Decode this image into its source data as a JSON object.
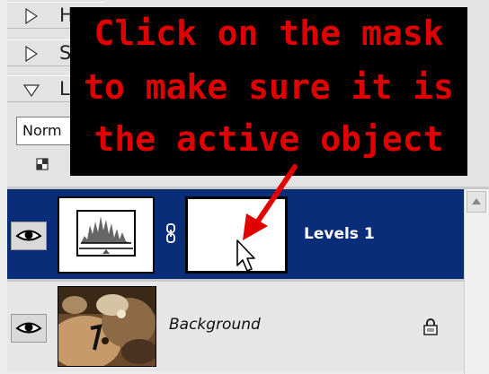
{
  "collapsed_panels": [
    {
      "label": "H"
    },
    {
      "label": "St"
    },
    {
      "label": "La"
    }
  ],
  "blend_mode": {
    "value": "Norm"
  },
  "callout": {
    "lines": [
      "Click on the mask",
      "to make sure it is",
      "the active object"
    ],
    "text_color": "#e00000",
    "background": "#000000"
  },
  "layers": [
    {
      "name": "Levels 1",
      "selected": true,
      "visible": true,
      "type": "adjustment",
      "icon": "levels-histogram-icon"
    },
    {
      "name": "Background",
      "selected": false,
      "visible": true,
      "locked": true,
      "type": "image",
      "icon": "photo-thumbnail"
    }
  ],
  "colors": {
    "selection": "#0a2d79",
    "arrow": "#e00000"
  }
}
